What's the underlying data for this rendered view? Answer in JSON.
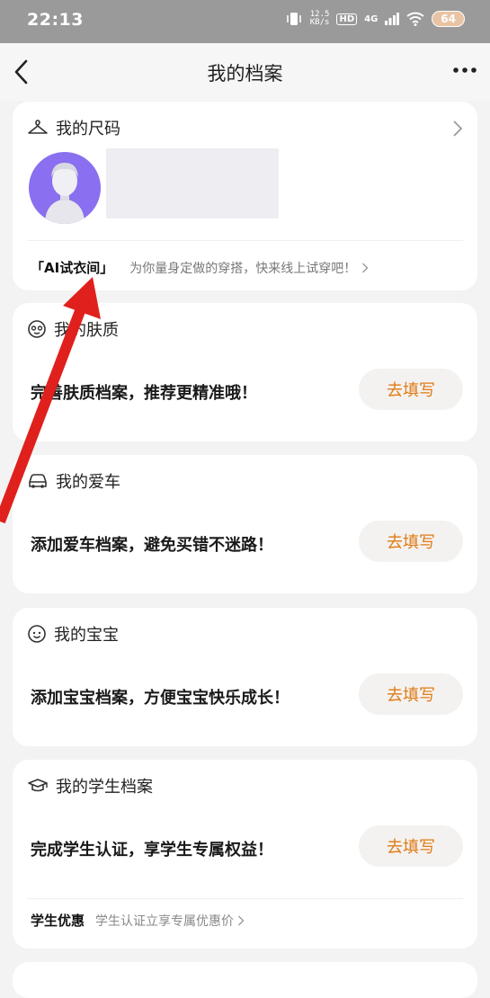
{
  "status_bar": {
    "time": "22:13",
    "net_speed_value": "12.5",
    "net_speed_unit": "KB/s",
    "hd": "HD",
    "network": "4G",
    "battery": "64"
  },
  "header": {
    "title": "我的档案"
  },
  "size_card": {
    "label": "我的尺码",
    "tryon_label": "「AI试衣间」",
    "tryon_desc": "为你量身定做的穿搭，快来线上试穿吧！"
  },
  "skin_card": {
    "label": "我的肤质",
    "message": "完善肤质档案，推荐更精准哦！",
    "button": "去填写"
  },
  "car_card": {
    "label": "我的爱车",
    "message": "添加爱车档案，避免买错不迷路！",
    "button": "去填写"
  },
  "baby_card": {
    "label": "我的宝宝",
    "message": "添加宝宝档案，方便宝宝快乐成长！",
    "button": "去填写"
  },
  "student_card": {
    "label": "我的学生档案",
    "message": "完成学生认证，享学生专属权益！",
    "button": "去填写",
    "offer_tag": "学生优惠",
    "offer_desc": "学生认证立享专属优惠价"
  },
  "colors": {
    "accent": "#e07b16",
    "annotation_arrow": "#e0201c",
    "avatar_bg": "#8a6ff0"
  }
}
